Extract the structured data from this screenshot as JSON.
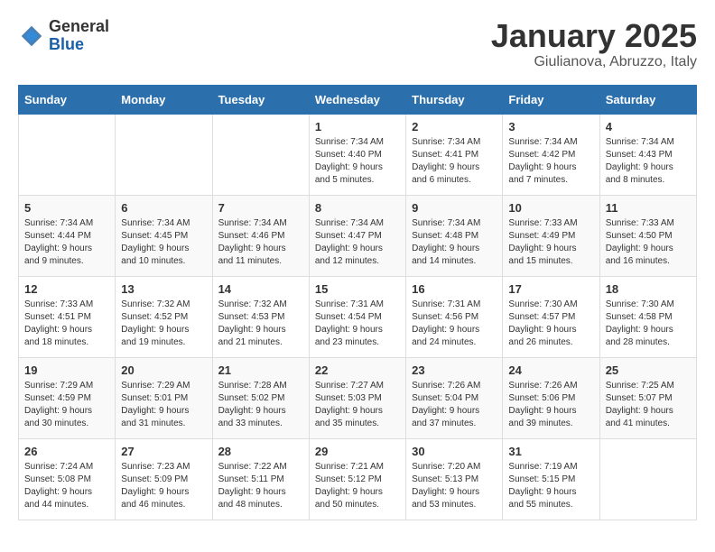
{
  "logo": {
    "general": "General",
    "blue": "Blue"
  },
  "header": {
    "title": "January 2025",
    "subtitle": "Giulianova, Abruzzo, Italy"
  },
  "weekdays": [
    "Sunday",
    "Monday",
    "Tuesday",
    "Wednesday",
    "Thursday",
    "Friday",
    "Saturday"
  ],
  "weeks": [
    [
      {
        "day": "",
        "sunrise": "",
        "sunset": "",
        "daylight": ""
      },
      {
        "day": "",
        "sunrise": "",
        "sunset": "",
        "daylight": ""
      },
      {
        "day": "",
        "sunrise": "",
        "sunset": "",
        "daylight": ""
      },
      {
        "day": "1",
        "sunrise": "Sunrise: 7:34 AM",
        "sunset": "Sunset: 4:40 PM",
        "daylight": "Daylight: 9 hours and 5 minutes."
      },
      {
        "day": "2",
        "sunrise": "Sunrise: 7:34 AM",
        "sunset": "Sunset: 4:41 PM",
        "daylight": "Daylight: 9 hours and 6 minutes."
      },
      {
        "day": "3",
        "sunrise": "Sunrise: 7:34 AM",
        "sunset": "Sunset: 4:42 PM",
        "daylight": "Daylight: 9 hours and 7 minutes."
      },
      {
        "day": "4",
        "sunrise": "Sunrise: 7:34 AM",
        "sunset": "Sunset: 4:43 PM",
        "daylight": "Daylight: 9 hours and 8 minutes."
      }
    ],
    [
      {
        "day": "5",
        "sunrise": "Sunrise: 7:34 AM",
        "sunset": "Sunset: 4:44 PM",
        "daylight": "Daylight: 9 hours and 9 minutes."
      },
      {
        "day": "6",
        "sunrise": "Sunrise: 7:34 AM",
        "sunset": "Sunset: 4:45 PM",
        "daylight": "Daylight: 9 hours and 10 minutes."
      },
      {
        "day": "7",
        "sunrise": "Sunrise: 7:34 AM",
        "sunset": "Sunset: 4:46 PM",
        "daylight": "Daylight: 9 hours and 11 minutes."
      },
      {
        "day": "8",
        "sunrise": "Sunrise: 7:34 AM",
        "sunset": "Sunset: 4:47 PM",
        "daylight": "Daylight: 9 hours and 12 minutes."
      },
      {
        "day": "9",
        "sunrise": "Sunrise: 7:34 AM",
        "sunset": "Sunset: 4:48 PM",
        "daylight": "Daylight: 9 hours and 14 minutes."
      },
      {
        "day": "10",
        "sunrise": "Sunrise: 7:33 AM",
        "sunset": "Sunset: 4:49 PM",
        "daylight": "Daylight: 9 hours and 15 minutes."
      },
      {
        "day": "11",
        "sunrise": "Sunrise: 7:33 AM",
        "sunset": "Sunset: 4:50 PM",
        "daylight": "Daylight: 9 hours and 16 minutes."
      }
    ],
    [
      {
        "day": "12",
        "sunrise": "Sunrise: 7:33 AM",
        "sunset": "Sunset: 4:51 PM",
        "daylight": "Daylight: 9 hours and 18 minutes."
      },
      {
        "day": "13",
        "sunrise": "Sunrise: 7:32 AM",
        "sunset": "Sunset: 4:52 PM",
        "daylight": "Daylight: 9 hours and 19 minutes."
      },
      {
        "day": "14",
        "sunrise": "Sunrise: 7:32 AM",
        "sunset": "Sunset: 4:53 PM",
        "daylight": "Daylight: 9 hours and 21 minutes."
      },
      {
        "day": "15",
        "sunrise": "Sunrise: 7:31 AM",
        "sunset": "Sunset: 4:54 PM",
        "daylight": "Daylight: 9 hours and 23 minutes."
      },
      {
        "day": "16",
        "sunrise": "Sunrise: 7:31 AM",
        "sunset": "Sunset: 4:56 PM",
        "daylight": "Daylight: 9 hours and 24 minutes."
      },
      {
        "day": "17",
        "sunrise": "Sunrise: 7:30 AM",
        "sunset": "Sunset: 4:57 PM",
        "daylight": "Daylight: 9 hours and 26 minutes."
      },
      {
        "day": "18",
        "sunrise": "Sunrise: 7:30 AM",
        "sunset": "Sunset: 4:58 PM",
        "daylight": "Daylight: 9 hours and 28 minutes."
      }
    ],
    [
      {
        "day": "19",
        "sunrise": "Sunrise: 7:29 AM",
        "sunset": "Sunset: 4:59 PM",
        "daylight": "Daylight: 9 hours and 30 minutes."
      },
      {
        "day": "20",
        "sunrise": "Sunrise: 7:29 AM",
        "sunset": "Sunset: 5:01 PM",
        "daylight": "Daylight: 9 hours and 31 minutes."
      },
      {
        "day": "21",
        "sunrise": "Sunrise: 7:28 AM",
        "sunset": "Sunset: 5:02 PM",
        "daylight": "Daylight: 9 hours and 33 minutes."
      },
      {
        "day": "22",
        "sunrise": "Sunrise: 7:27 AM",
        "sunset": "Sunset: 5:03 PM",
        "daylight": "Daylight: 9 hours and 35 minutes."
      },
      {
        "day": "23",
        "sunrise": "Sunrise: 7:26 AM",
        "sunset": "Sunset: 5:04 PM",
        "daylight": "Daylight: 9 hours and 37 minutes."
      },
      {
        "day": "24",
        "sunrise": "Sunrise: 7:26 AM",
        "sunset": "Sunset: 5:06 PM",
        "daylight": "Daylight: 9 hours and 39 minutes."
      },
      {
        "day": "25",
        "sunrise": "Sunrise: 7:25 AM",
        "sunset": "Sunset: 5:07 PM",
        "daylight": "Daylight: 9 hours and 41 minutes."
      }
    ],
    [
      {
        "day": "26",
        "sunrise": "Sunrise: 7:24 AM",
        "sunset": "Sunset: 5:08 PM",
        "daylight": "Daylight: 9 hours and 44 minutes."
      },
      {
        "day": "27",
        "sunrise": "Sunrise: 7:23 AM",
        "sunset": "Sunset: 5:09 PM",
        "daylight": "Daylight: 9 hours and 46 minutes."
      },
      {
        "day": "28",
        "sunrise": "Sunrise: 7:22 AM",
        "sunset": "Sunset: 5:11 PM",
        "daylight": "Daylight: 9 hours and 48 minutes."
      },
      {
        "day": "29",
        "sunrise": "Sunrise: 7:21 AM",
        "sunset": "Sunset: 5:12 PM",
        "daylight": "Daylight: 9 hours and 50 minutes."
      },
      {
        "day": "30",
        "sunrise": "Sunrise: 7:20 AM",
        "sunset": "Sunset: 5:13 PM",
        "daylight": "Daylight: 9 hours and 53 minutes."
      },
      {
        "day": "31",
        "sunrise": "Sunrise: 7:19 AM",
        "sunset": "Sunset: 5:15 PM",
        "daylight": "Daylight: 9 hours and 55 minutes."
      },
      {
        "day": "",
        "sunrise": "",
        "sunset": "",
        "daylight": ""
      }
    ]
  ]
}
